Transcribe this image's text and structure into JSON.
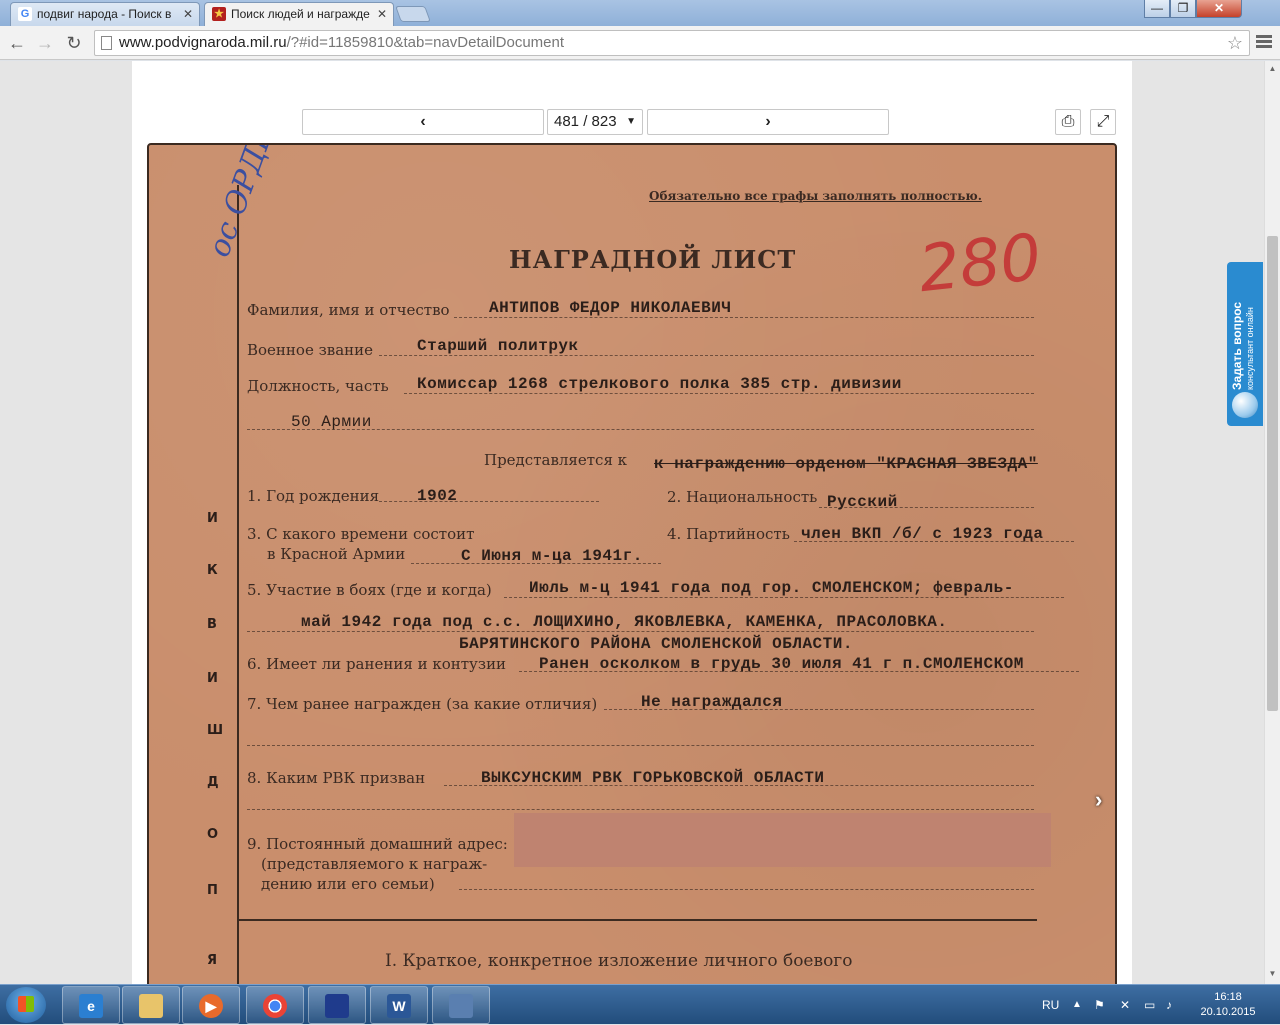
{
  "tabs": [
    {
      "title": "подвиг народа - Поиск в",
      "favicon": "G",
      "active": false
    },
    {
      "title": "Поиск людей и награжде",
      "favicon": "★",
      "active": true
    }
  ],
  "window_controls": {
    "minimize": "—",
    "maximize": "❐",
    "close": "✕"
  },
  "address": {
    "host": "www.podvignaroda.mil.ru",
    "path": "/?#id=11859810&tab=navDetailDocument"
  },
  "viewer": {
    "prev_icon": "‹",
    "next_icon": "›",
    "page_selector": "481 / 823",
    "print_icon": "print-icon",
    "fullscreen_icon": "fullscreen-icon"
  },
  "document": {
    "note": "Обязательно все графы заполнять полностью.",
    "title": "НАГРАДНОЙ ЛИСТ",
    "number_stamp": "280",
    "handwriting_corner": "ос ОРДЕР",
    "fio_label": "Фамилия, имя и отчество",
    "fio_value": "АНТИПОВ  ФЕДОР НИКОЛАЕВИЧ",
    "rank_label": "Военное звание",
    "rank_value": "Старший политрук",
    "position_label": "Должность, часть",
    "position_value": "Комиссар  1268  стрелкового полка 385 стр. дивизии",
    "position_value2": "50 Армии",
    "presented_label": "Представляется к",
    "presented_value": "к награждению орденом \"КРАСНАЯ ЗВЕЗДА\"",
    "f1_label": "1. Год рождения",
    "f1_value": "1902",
    "f2_label": "2. Национальность",
    "f2_value": "Русский",
    "f3_label": "3. С какого времени состоит",
    "f3_label2": "в Красной Армии",
    "f3_value": "С Июня м-ца 1941г.",
    "f4_label": "4. Партийность",
    "f4_value": "член ВКП /б/ с 1923 года",
    "f5_label": "5. Участие в боях (где и когда)",
    "f5_value": "Июль м-ц 1941 года под гор. СМОЛЕНСКОМ; февраль-",
    "f5_value2": "май  1942 года под с.с. ЛОЩИХИНО, ЯКОВЛЕВКА, КАМЕНКА, ПРАСОЛОВКА.",
    "f5_value3": "БАРЯТИНСКОГО РАЙОНА  СМОЛЕНСКОЙ ОБЛАСТИ.",
    "f6_label": "6. Имеет ли ранения и контузии",
    "f6_value": "Ранен осколком в грудь 30 июля 41 г п.СМОЛЕНСКОМ",
    "f7_label": "7. Чем ранее награжден (за какие отличия)",
    "f7_value": "Не награждался",
    "f8_label": "8. Каким РВК призван",
    "f8_value": "ВЫКСУНСКИМ РВК ГОРЬКОВСКОЙ ОБЛАСТИ",
    "f9_label": "9. Постоянный домашний адрес:",
    "f9_label2": "(представляемого к награж-",
    "f9_label3": "дению или его семьи)",
    "section1": "I. Краткое, конкретное изложение личного боевого",
    "side_letters": [
      "Я",
      "П",
      "О",
      "Д",
      "Ш",
      "И",
      "В",
      "К",
      "И"
    ]
  },
  "ask_widget": {
    "title": "Задать вопрос",
    "subtitle": "консультант онлайн"
  },
  "taskbar": {
    "lang": "RU",
    "time": "16:18",
    "date": "20.10.2015",
    "apps": [
      "internet-explorer-icon",
      "file-explorer-icon",
      "media-player-icon",
      "chrome-icon",
      "save-disk-icon",
      "word-icon",
      "network-app-icon"
    ]
  }
}
